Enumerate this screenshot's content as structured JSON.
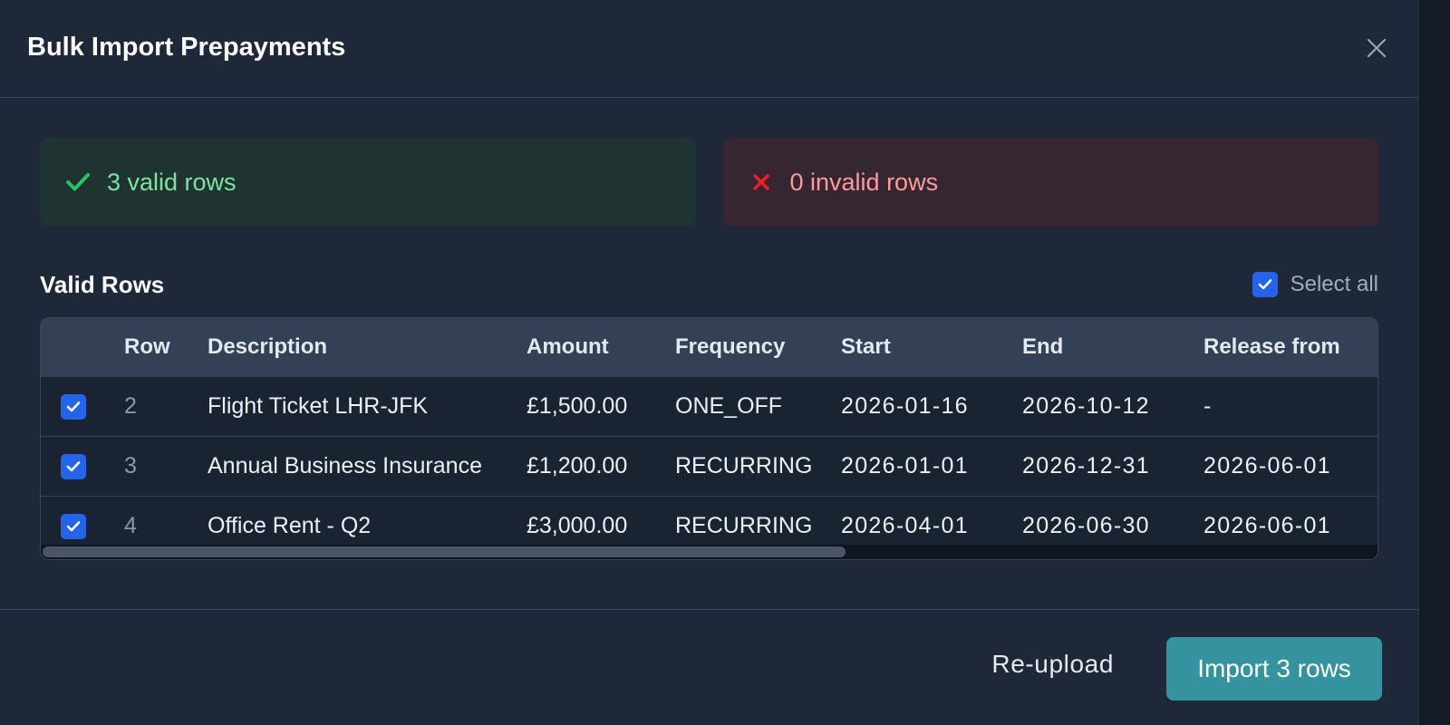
{
  "modal": {
    "title": "Bulk Import Prepayments"
  },
  "summary": {
    "valid_label": "3 valid rows",
    "invalid_label": "0 invalid rows"
  },
  "section": {
    "title": "Valid Rows",
    "select_all_label": "Select all",
    "select_all_checked": true
  },
  "table": {
    "headers": {
      "row": "Row",
      "description": "Description",
      "amount": "Amount",
      "frequency": "Frequency",
      "start": "Start",
      "end": "End",
      "release_from": "Release from"
    },
    "rows": [
      {
        "checked": true,
        "row": "2",
        "description": "Flight Ticket LHR-JFK",
        "amount": "£1,500.00",
        "frequency": "ONE_OFF",
        "start": "2026-01-16",
        "end": "2026-10-12",
        "release_from": "-"
      },
      {
        "checked": true,
        "row": "3",
        "description": "Annual Business Insurance",
        "amount": "£1,200.00",
        "frequency": "RECURRING",
        "start": "2026-01-01",
        "end": "2026-12-31",
        "release_from": "2026-06-01"
      },
      {
        "checked": true,
        "row": "4",
        "description": "Office Rent - Q2",
        "amount": "£3,000.00",
        "frequency": "RECURRING",
        "start": "2026-04-01",
        "end": "2026-06-30",
        "release_from": "2026-06-01"
      }
    ]
  },
  "footer": {
    "reupload_label": "Re-upload",
    "import_label": "Import 3 rows"
  },
  "colors": {
    "modal_bg": "#1e2838",
    "valid_accent": "#22c55e",
    "invalid_accent": "#ef1c2c",
    "checkbox": "#2563eb",
    "primary_button": "#3593a0"
  },
  "icons": {
    "close": "close-icon",
    "valid": "check-icon",
    "invalid": "x-icon",
    "checkbox": "checkmark-icon"
  }
}
